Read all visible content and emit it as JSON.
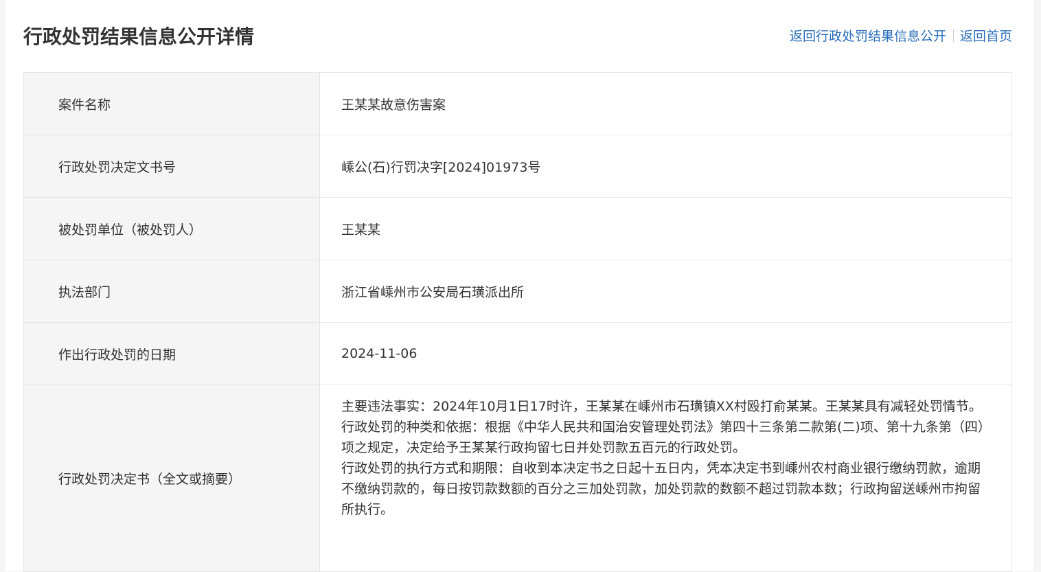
{
  "header": {
    "title": "行政处罚结果信息公开详情",
    "links": {
      "back_to_list": "返回行政处罚结果信息公开",
      "back_to_home": "返回首页"
    }
  },
  "colors": {
    "link": "#2a6ebb",
    "label_background": "#f5f5f5",
    "border": "#e6e6e6",
    "text": "#333333"
  },
  "details": {
    "case_name": {
      "label": "案件名称",
      "value": "王某某故意伤害案"
    },
    "decision_number": {
      "label": "行政处罚决定文书号",
      "value": "嵊公(石)行罚决字[2024]01973号"
    },
    "penalized_party": {
      "label": "被处罚单位（被处罚人）",
      "value": "王某某"
    },
    "enforcement_department": {
      "label": "执法部门",
      "value": "浙江省嵊州市公安局石璜派出所"
    },
    "decision_date": {
      "label": "作出行政处罚的日期",
      "value": "2024-11-06"
    },
    "decision_text": {
      "label": "行政处罚决定书（全文或摘要）",
      "facts": "主要违法事实：2024年10月1日17时许，王某某在嵊州市石璜镇XX村殴打俞某某。王某某具有减轻处罚情节。",
      "basis": "行政处罚的种类和依据：根据《中华人民共和国治安管理处罚法》第四十三条第二款第(二)项、第十九条第（四）项之规定，决定给予王某某行政拘留七日并处罚款五百元的行政处罚。",
      "execution": "行政处罚的执行方式和期限：自收到本决定书之日起十五日内，凭本决定书到嵊州农村商业银行缴纳罚款，逾期不缴纳罚款的，每日按罚款数额的百分之三加处罚款，加处罚款的数额不超过罚款本数；行政拘留送嵊州市拘留所执行。"
    }
  }
}
